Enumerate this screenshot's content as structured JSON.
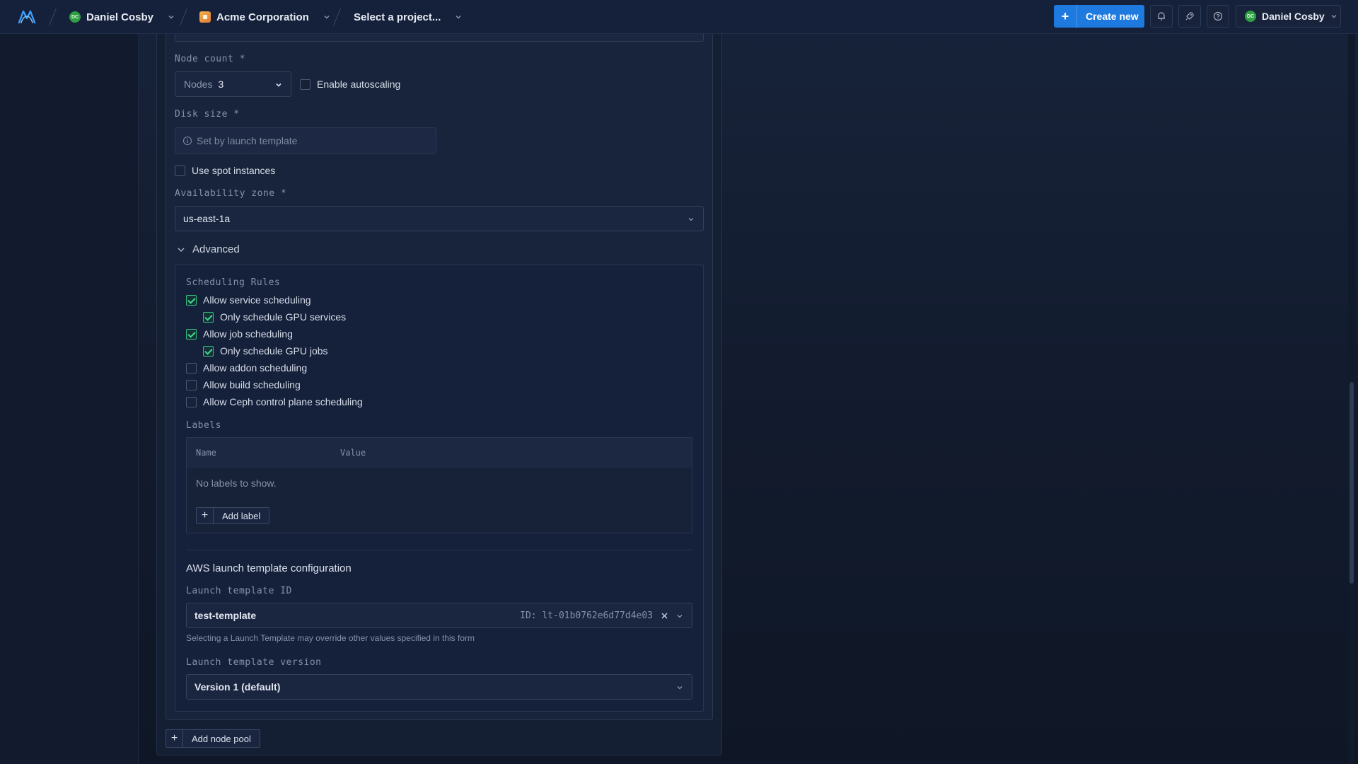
{
  "nav": {
    "user_initials": "DC",
    "user_name": "Daniel Cosby",
    "org_name": "Acme Corporation",
    "project_placeholder": "Select a project...",
    "create_new_label": "Create new",
    "account_name": "Daniel Cosby",
    "account_initials": "DC"
  },
  "form": {
    "node_count_label": "Node count *",
    "nodes_prefix": "Nodes",
    "nodes_value": "3",
    "autoscaling_label": "Enable autoscaling",
    "autoscaling_checked": false,
    "disk_size_label": "Disk size *",
    "disk_size_placeholder": "Set by launch template",
    "spot_label": "Use spot instances",
    "spot_checked": false,
    "az_label": "Availability zone *",
    "az_value": "us-east-1a",
    "advanced_label": "Advanced"
  },
  "advanced": {
    "scheduling_title": "Scheduling Rules",
    "rules": [
      {
        "label": "Allow service scheduling",
        "checked": true,
        "indent": 0
      },
      {
        "label": "Only schedule GPU services",
        "checked": true,
        "indent": 1
      },
      {
        "label": "Allow job scheduling",
        "checked": true,
        "indent": 0
      },
      {
        "label": "Only schedule GPU jobs",
        "checked": true,
        "indent": 1
      },
      {
        "label": "Allow addon scheduling",
        "checked": false,
        "indent": 0
      },
      {
        "label": "Allow build scheduling",
        "checked": false,
        "indent": 0
      },
      {
        "label": "Allow Ceph control plane scheduling",
        "checked": false,
        "indent": 0
      }
    ],
    "labels_title": "Labels",
    "labels_col_name": "Name",
    "labels_col_value": "Value",
    "labels_empty": "No labels to show.",
    "add_label": "Add label",
    "aws_title": "AWS launch template configuration",
    "lt_id_label": "Launch template ID",
    "lt_name": "test-template",
    "lt_id_value": "ID: lt-01b0762e6d77d4e03",
    "lt_hint": "Selecting a Launch Template may override other values specified in this form",
    "lt_version_label": "Launch template version",
    "lt_version_value": "Version 1 (default)"
  },
  "footer": {
    "add_node_pool": "Add node pool"
  },
  "colors": {
    "accent": "#1f7ae0",
    "check_green": "#3ddc8a",
    "avatar_green": "#2ea043"
  }
}
